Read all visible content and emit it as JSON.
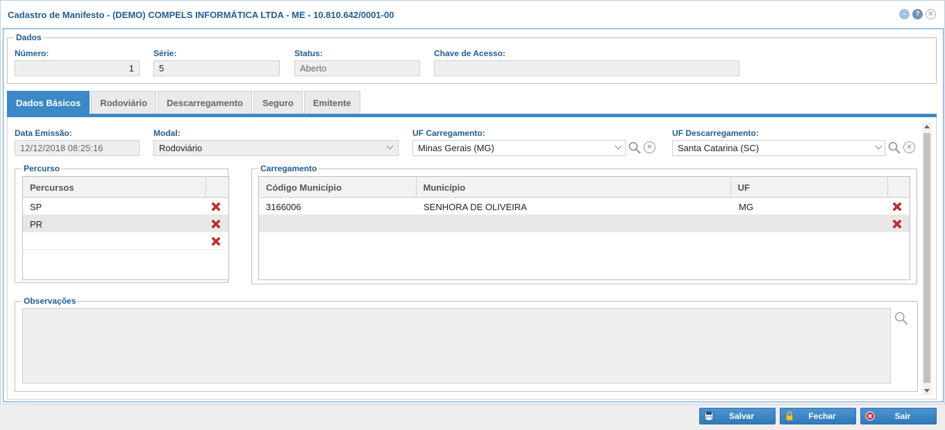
{
  "window": {
    "title": "Cadastro de Manifesto - (DEMO) COMPELS INFORMÁTICA LTDA - ME - 10.810.642/0001-00",
    "icons": [
      "minimize-icon",
      "help-icon",
      "close-icon"
    ]
  },
  "dados": {
    "legend": "Dados",
    "numero_label": "Número:",
    "numero_value": "1",
    "serie_label": "Série:",
    "serie_value": "5",
    "status_label": "Status:",
    "status_value": "Aberto",
    "chave_label": "Chave de Acesso:",
    "chave_value": ""
  },
  "tabs": [
    {
      "label": "Dados Básicos",
      "active": true
    },
    {
      "label": "Rodoviário",
      "active": false
    },
    {
      "label": "Descarregamento",
      "active": false
    },
    {
      "label": "Seguro",
      "active": false
    },
    {
      "label": "Emitente",
      "active": false
    }
  ],
  "basicos": {
    "data_emissao_label": "Data Emissão:",
    "data_emissao_value": "12/12/2018 08:25:16",
    "modal_label": "Modal:",
    "modal_value": "Rodoviário",
    "uf_carregamento_label": "UF Carregamento:",
    "uf_carregamento_value": "Minas Gerais (MG)",
    "uf_descarregamento_label": "UF Descarregamento:",
    "uf_descarregamento_value": "Santa Catarina (SC)"
  },
  "percurso": {
    "legend": "Percurso",
    "header": "Percursos",
    "rows": [
      "SP",
      "PR",
      ""
    ]
  },
  "carregamento": {
    "legend": "Carregamento",
    "headers": [
      "Código Município",
      "Município",
      "UF"
    ],
    "rows": [
      [
        "3166006",
        "SENHORA DE OLIVEIRA",
        "MG"
      ],
      [
        "",
        "",
        ""
      ]
    ]
  },
  "observacoes": {
    "legend": "Observações",
    "value": ""
  },
  "buttons": {
    "salvar": "Salvar",
    "fechar": "Fechar",
    "sair": "Sair"
  },
  "colors": {
    "accent": "#3b89c7",
    "label": "#1f5e93",
    "delete": "#d9232b"
  }
}
